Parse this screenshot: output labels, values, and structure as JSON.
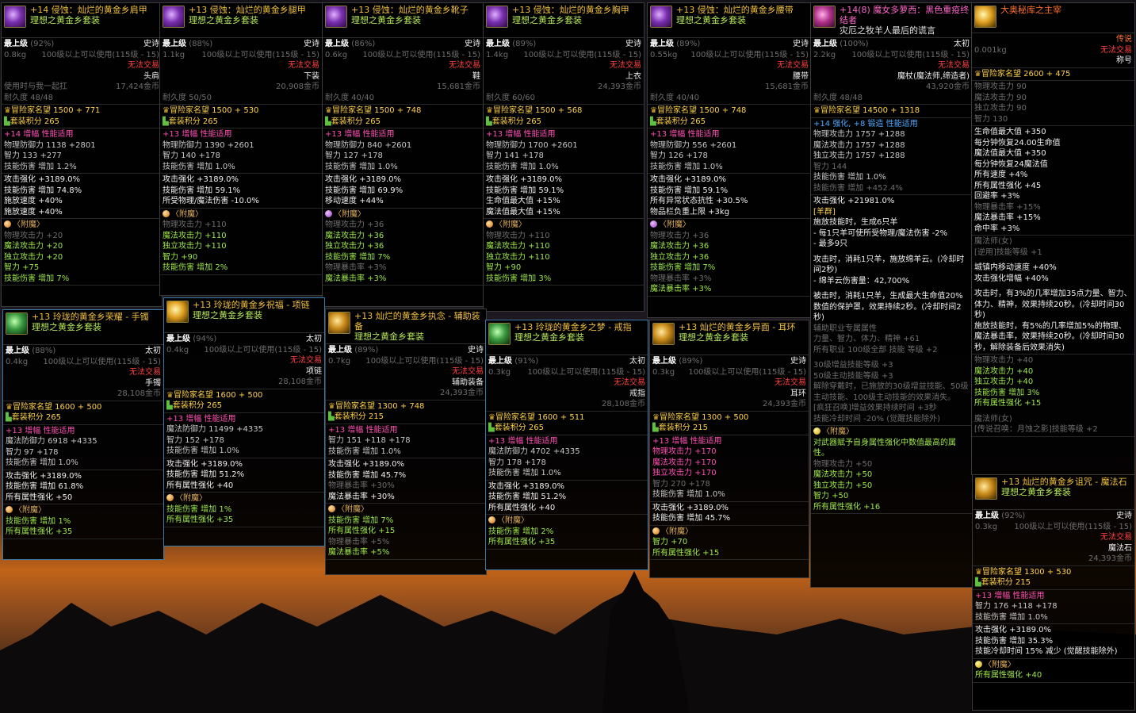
{
  "cards": [
    {
      "id": "c1",
      "name": "+14 侵蚀：灿烂的黄金乡肩甲",
      "set": "理想之黄金乡套装",
      "grade": "最上级",
      "pct": "(92%)",
      "rarity": "史诗",
      "weight": "0.8kg",
      "req": "100级以上可以使用(115级 - 15)",
      "trade": "无法交易",
      "slot": "头肩",
      "line5": "使用时与我一起扛",
      "price": "17,424金币",
      "durability": "耐久度 48/48",
      "renown": "冒险家名望 1500 + 771",
      "setscore": "套装积分 265",
      "amp": "+14 增幅 性能适用",
      "p1": "物理防御力 1138 +2801",
      "p2": "智力 133 +277",
      "p3": "技能伤害 增加 1.2%",
      "s1": "攻击强化 +3189.0%",
      "s2": "技能伤害 增加 74.8%",
      "s3": "施放速度 +40%",
      "s4": "施放速度 +40%",
      "ench": "〈附魔〉",
      "e1": "物理攻击力 +20",
      "e2": "魔法攻击力 +20",
      "e3": "独立攻击力 +20",
      "e4": "智力 +75",
      "e5": "技能伤害 增加 7%"
    },
    {
      "id": "c2",
      "name": "+13 侵蚀：灿烂的黄金乡腿甲",
      "set": "理想之黄金乡套装",
      "grade": "最上级",
      "pct": "(88%)",
      "rarity": "史诗",
      "weight": "1.1kg",
      "req": "100级以上可以使用(115级 - 15)",
      "trade": "无法交易",
      "slot": "下装",
      "price": "20,908金币",
      "durability": "耐久度 50/50",
      "renown": "冒险家名望 1500 + 530",
      "setscore": "套装积分 265",
      "amp": "+13 增幅 性能适用",
      "p1": "物理防御力 1390 +2601",
      "p2": "智力 140 +178",
      "p3": "技能伤害 增加 1.0%",
      "s1": "攻击强化 +3189.0%",
      "s2": "技能伤害 增加 59.1%",
      "s3": "所受物理/魔法伤害 -10.0%",
      "ench": "〈附魔〉",
      "e1": "物理攻击力 +110",
      "e2": "魔法攻击力 +110",
      "e3": "独立攻击力 +110",
      "e4": "智力 +90",
      "e5": "技能伤害 增加 2%"
    },
    {
      "id": "c3",
      "name": "+13 侵蚀：灿烂的黄金乡靴子",
      "set": "理想之黄金乡套装",
      "grade": "最上级",
      "pct": "(86%)",
      "rarity": "史诗",
      "weight": "0.6kg",
      "req": "100级以上可以使用(115级 - 15)",
      "trade": "无法交易",
      "slot": "鞋",
      "price": "15,681金币",
      "durability": "耐久度 40/40",
      "renown": "冒险家名望 1500 + 748",
      "setscore": "套装积分 265",
      "amp": "+13 增幅 性能适用",
      "p1": "物理防御力 840 +2601",
      "p2": "智力 127 +178",
      "p3": "技能伤害 增加 1.0%",
      "s1": "攻击强化 +3189.0%",
      "s2": "技能伤害 增加 69.9%",
      "s3": "移动速度 +44%",
      "ench": "〈附魔〉",
      "e1": "物理攻击力 +36",
      "e2": "魔法攻击力 +36",
      "e3": "独立攻击力 +36",
      "e4": "技能伤害 增加 7%",
      "e5": "物理暴击率 +3%",
      "e6": "魔法暴击率 +3%"
    },
    {
      "id": "c4",
      "name": "+13 侵蚀：灿烂的黄金乡胸甲",
      "set": "理想之黄金乡套装",
      "grade": "最上级",
      "pct": "(89%)",
      "rarity": "史诗",
      "weight": "1.4kg",
      "req": "100级以上可以使用(115级 - 15)",
      "trade": "无法交易",
      "slot": "上衣",
      "price": "24,393金币",
      "durability": "耐久度 60/60",
      "renown": "冒险家名望 1500 + 568",
      "setscore": "套装积分 265",
      "amp": "+13 增幅 性能适用",
      "p1": "物理防御力 1700 +2601",
      "p2": "智力 141 +178",
      "p3": "技能伤害 增加 1.0%",
      "s1": "攻击强化 +3189.0%",
      "s2": "技能伤害 增加 59.1%",
      "s3": "生命值最大值 +15%",
      "s4": "魔法值最大值 +15%",
      "ench": "〈附魔〉",
      "e1": "物理攻击力 +110",
      "e2": "魔法攻击力 +110",
      "e3": "独立攻击力 +110",
      "e4": "智力 +90",
      "e5": "技能伤害 增加 3%"
    },
    {
      "id": "c5",
      "name": "+13 侵蚀：灿烂的黄金乡腰带",
      "set": "理想之黄金乡套装",
      "grade": "最上级",
      "pct": "(89%)",
      "rarity": "史诗",
      "weight": "0.55kg",
      "req": "100级以上可以使用(115级 - 15)",
      "trade": "无法交易",
      "slot": "腰带",
      "price": "15,681金币",
      "durability": "耐久度 40/40",
      "renown": "冒险家名望 1500 + 748",
      "setscore": "套装积分 265",
      "amp": "+13 增幅 性能适用",
      "p1": "物理防御力 556 +2601",
      "p2": "智力 126 +178",
      "p3": "技能伤害 增加 1.0%",
      "s1": "攻击强化 +3189.0%",
      "s2": "技能伤害 增加 59.1%",
      "s3": "所有异常状态抗性 +30.5%",
      "s4": "物品栏负重上限 +3kg",
      "ench": "〈附魔〉",
      "e1": "物理攻击力 +36",
      "e2": "魔法攻击力 +36",
      "e3": "独立攻击力 +36",
      "e4": "技能伤害 增加 7%",
      "e5": "物理暴击率 +3%",
      "e6": "魔法暴击率 +3%"
    },
    {
      "id": "c6",
      "name": "+14(8) 魔女多萝西：黑色重疫终结者",
      "subtitle": "灾厄之牧羊人最后的谎言",
      "grade": "最上级",
      "pct": "(100%)",
      "rarity": "太初",
      "weight": "2.2kg",
      "req": "100级以上可以使用(115级 - 15)",
      "trade": "无法交易",
      "slot": "魔杖(魔法师,缔造者)",
      "price": "43,920金币",
      "durability": "耐久度 48/48",
      "renown": "冒险家名望 14500 + 1318",
      "amp": "+14 强化, +8 锻造 性能适用",
      "p1": "物理攻击力 1757 +1288",
      "p2": "魔法攻击力 1757 +1288",
      "p3": "独立攻击力 1757 +1288",
      "p4": "智力 144",
      "p5": "技能伤害 增加 1.0%",
      "p6": "技能伤害 增加 +452.4%",
      "s1": "攻击强化 +21981.0%",
      "t1": "[羊群]",
      "t2": "施放技能时，生成6只羊",
      "t3": "- 每1只羊可使所受物理/魔法伤害 -2%",
      "t4": "- 最多9只",
      "t5": "攻击时，消耗1只羊，施放绵羊云。(冷却时间2秒)",
      "t6": "- 绵羊云伤害量：42,700%",
      "t7": "被击时，消耗1只羊，生成最大生命值20%数值的保护罩，效果持续2秒。(冷却时间2秒)",
      "t8": "辅助职业专属属性",
      "t9": "力量、智力、体力、精神 +61",
      "t10": "所有职业 100级全部 技能 等级 +2",
      "t11": "30级增益技能等级 +3",
      "t12": "50级主动技能等级 +3",
      "t13": "解除穿戴时，已施放的30级增益技能、50级主动技能、100级主动技能的效果消失。",
      "t14": "[疯狂召唤]增益效果持续时间 +3秒",
      "t15": "技能冷却时间 -20% (觉醒技能除外)",
      "ench": "〈附魔〉",
      "ed": "对武器赋予自身属性强化中数值最高的属性。",
      "e1": "物理攻击力 +50",
      "e2": "魔法攻击力 +50",
      "e3": "独立攻击力 +50",
      "e4": "智力 +50",
      "e5": "所有属性强化 +16"
    },
    {
      "id": "c7",
      "name": "大奥秘库之主宰",
      "weight": "0.001kg",
      "rarity": "传说",
      "trade": "无法交易",
      "slot": "称号",
      "renown": "冒险家名望 2600 + 475",
      "p1": "物理攻击力 90",
      "p2": "魔法攻击力 90",
      "p3": "独立攻击力 90",
      "p4": "智力 130",
      "s1": "生命值最大值 +350",
      "s2": "每分钟恢复24.00生命值",
      "s3": "魔法值最大值 +350",
      "s4": "每分钟恢复24魔法值",
      "s5": "所有速度 +4%",
      "s6": "所有属性强化 +45",
      "s7": "回避率 +3%",
      "s8": "物理暴击率 +15%",
      "s9": "魔法暴击率 +15%",
      "s10": "命中率 +3%",
      "j1": "魔法师(女)",
      "j2": "[逆用]技能等级 +1",
      "j3": "城镇内移动速度 +40%",
      "j4": "攻击强化增幅 +40%",
      "j5": "攻击时，有3%的几率增加35点力量、智力、体力、精神，效果持续20秒。(冷却时间30秒)",
      "j6": "施放技能时，有5%的几率增加5%的物理、魔法暴击率，效果持续20秒。(冷却时间30秒，解除装备后效果消失)",
      "k1": "物理攻击力 +40",
      "k2": "魔法攻击力 +40",
      "k3": "独立攻击力 +40",
      "k4": "技能伤害 增加 3%",
      "k5": "所有属性强化 +15",
      "k6": "魔法师(女)",
      "k7": "[传说召唤：月蚀之影]技能等级 +2"
    },
    {
      "id": "c8",
      "name": "+13 玲珑的黄金乡荣耀 - 手镯",
      "set": "理想之黄金乡套装",
      "grade": "最上级",
      "pct": "(88%)",
      "rarity": "太初",
      "weight": "0.4kg",
      "req": "100级以上可以使用(115级 - 15)",
      "trade": "无法交易",
      "slot": "手镯",
      "price": "28,108金币",
      "renown": "冒险家名望 1600 + 500",
      "setscore": "套装积分 265",
      "amp": "+13 增幅 性能适用",
      "p1": "魔法防御力 6918 +4335",
      "p2": "智力 97 +178",
      "p3": "技能伤害 增加 1.0%",
      "s1": "攻击强化 +3189.0%",
      "s2": "技能伤害 增加 61.8%",
      "s3": "所有属性强化 +50",
      "ench": "〈附魔〉",
      "e1": "技能伤害 增加 1%",
      "e2": "所有属性强化 +35"
    },
    {
      "id": "c9",
      "name": "+13 玲珑的黄金乡祝福 - 项链",
      "set": "理想之黄金乡套装",
      "grade": "最上级",
      "pct": "(94%)",
      "rarity": "太初",
      "weight": "0.4kg",
      "req": "100级以上可以使用(115级 - 15)",
      "trade": "无法交易",
      "slot": "项链",
      "price": "28,108金币",
      "renown": "冒险家名望 1600 + 500",
      "setscore": "套装积分 265",
      "amp": "+13 增幅 性能适用",
      "p1": "魔法防御力 11499 +4335",
      "p2": "智力 152 +178",
      "p3": "技能伤害 增加 1.0%",
      "s1": "攻击强化 +3189.0%",
      "s2": "技能伤害 增加 51.2%",
      "s3": "所有属性强化 +40",
      "ench": "〈附魔〉",
      "e1": "技能伤害 增加 1%",
      "e2": "所有属性强化 +35"
    },
    {
      "id": "c10",
      "name": "+13 灿烂的黄金乡执念 - 辅助装备",
      "set": "理想之黄金乡套装",
      "grade": "最上级",
      "pct": "(89%)",
      "rarity": "史诗",
      "weight": "0.7kg",
      "req": "100级以上可以使用(115级 - 15)",
      "trade": "无法交易",
      "slot": "辅助装备",
      "price": "24,393金币",
      "renown": "冒险家名望 1300 + 748",
      "setscore": "套装积分 215",
      "amp": "+13 增幅 性能适用",
      "p1": "智力 151 +118 +178",
      "p3": "技能伤害 增加 1.0%",
      "s1": "攻击强化 +3189.0%",
      "s2": "技能伤害 增加 45.7%",
      "s3": "物理暴击率 +30%",
      "s4": "魔法暴击率 +30%",
      "ench": "〈附魔〉",
      "e1": "技能伤害 增加 7%",
      "e2": "所有属性强化 +15",
      "e3": "物理暴击率 +5%",
      "e4": "魔法暴击率 +5%"
    },
    {
      "id": "c11",
      "name": "+13 玲珑的黄金乡之梦 - 戒指",
      "set": "理想之黄金乡套装",
      "grade": "最上级",
      "pct": "(91%)",
      "rarity": "太初",
      "weight": "0.3kg",
      "req": "100级以上可以使用(115级 - 15)",
      "trade": "无法交易",
      "slot": "戒指",
      "price": "28,108金币",
      "renown": "冒险家名望 1600 + 511",
      "setscore": "套装积分 265",
      "amp": "+13 增幅 性能适用",
      "p1": "魔法防御力 4702 +4335",
      "p2": "智力 178 +178",
      "p3": "技能伤害 增加 1.0%",
      "s1": "攻击强化 +3189.0%",
      "s2": "技能伤害 增加 51.2%",
      "s3": "所有属性强化 +40",
      "ench": "〈附魔〉",
      "e1": "技能伤害 增加 2%",
      "e2": "所有属性强化 +35"
    },
    {
      "id": "c12",
      "name": "+13 灿烂的黄金乡异面 - 耳环",
      "set": "理想之黄金乡套装",
      "grade": "最上级",
      "pct": "(89%)",
      "rarity": "史诗",
      "weight": "0.3kg",
      "req": "100级以上可以使用(115级 - 15)",
      "trade": "无法交易",
      "slot": "耳环",
      "price": "24,393金币",
      "renown": "冒险家名望 1300 + 500",
      "setscore": "套装积分 215",
      "amp": "+13 增幅 性能适用",
      "p1": "物理攻击力 +170",
      "p2": "魔法攻击力 +170",
      "p3": "独立攻击力 +170",
      "p4": "智力 270 +178",
      "p5": "技能伤害 增加 1.0%",
      "s1": "攻击强化 +3189.0%",
      "s2": "技能伤害 增加 45.7%",
      "ench": "〈附魔〉",
      "e1": "智力 +70",
      "e2": "所有属性强化 +15"
    },
    {
      "id": "c13",
      "name": "+13 灿烂的黄金乡诅咒 - 魔法石",
      "set": "理想之黄金乡套装",
      "grade": "最上级",
      "pct": "(92%)",
      "rarity": "史诗",
      "weight": "0.3kg",
      "req": "100级以上可以使用(115级 - 15)",
      "trade": "无法交易",
      "slot": "魔法石",
      "price": "24,393金币",
      "renown": "冒险家名望 1300 + 530",
      "setscore": "套装积分 215",
      "amp": "+13 增幅 性能适用",
      "p1": "智力 176 +118 +178",
      "p2": "技能伤害 增加 1.0%",
      "s1": "攻击强化 +3189.0%",
      "s2": "技能伤害 增加 35.3%",
      "s3": "技能冷却时间 15% 减少 (觉醒技能除外)",
      "ench": "〈附魔〉",
      "e1": "所有属性强化 +40"
    }
  ]
}
